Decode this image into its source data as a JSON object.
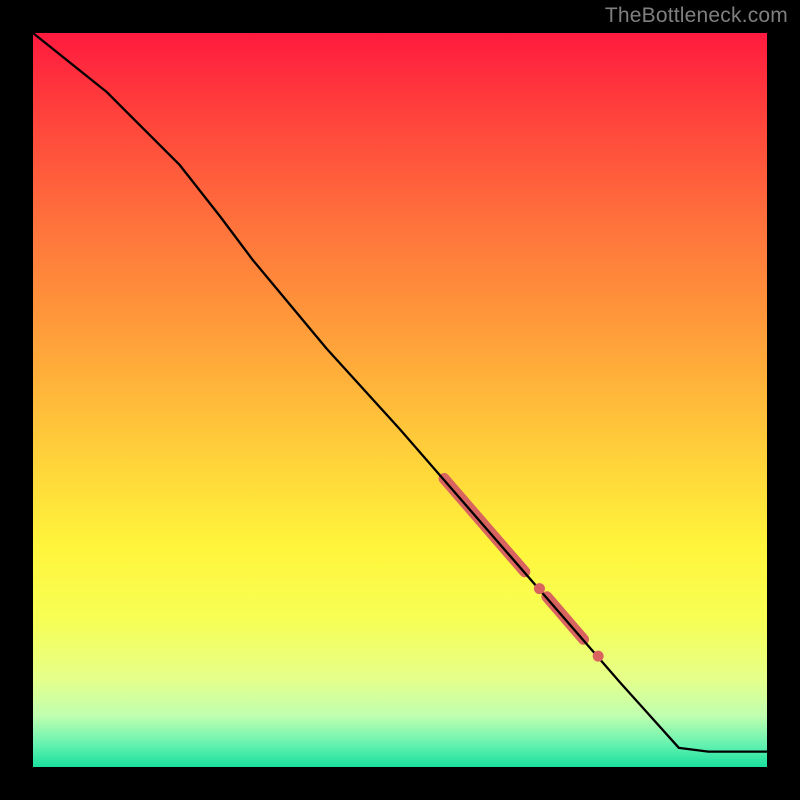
{
  "attribution": "TheBottleneck.com",
  "colors": {
    "line": "#000000",
    "highlight": "#d9635f",
    "background_top": "#ff1a3f",
    "background_bottom": "#1adf9d"
  },
  "chart_data": {
    "type": "line",
    "title": "",
    "xlabel": "",
    "ylabel": "",
    "xlim": [
      0,
      100
    ],
    "ylim": [
      0,
      100
    ],
    "axes_hidden": true,
    "background": "red-to-green vertical gradient (bottleneck heatmap)",
    "series": [
      {
        "name": "curve",
        "x": [
          0,
          10,
          20,
          25.5,
          30,
          40,
          50,
          60,
          70,
          80,
          88,
          92,
          100
        ],
        "y": [
          100,
          92,
          82,
          75,
          69,
          57,
          46,
          34.5,
          23,
          11.5,
          2.6,
          2.1,
          2.1
        ]
      }
    ],
    "highlight_segments": [
      {
        "x0": 56,
        "y0": 39.3,
        "x1": 67,
        "y1": 26.6
      },
      {
        "x0": 70,
        "y0": 23.2,
        "x1": 75,
        "y1": 17.4
      }
    ],
    "highlight_points": [
      {
        "x": 69,
        "y": 24.3
      },
      {
        "x": 77,
        "y": 15.1
      }
    ]
  }
}
